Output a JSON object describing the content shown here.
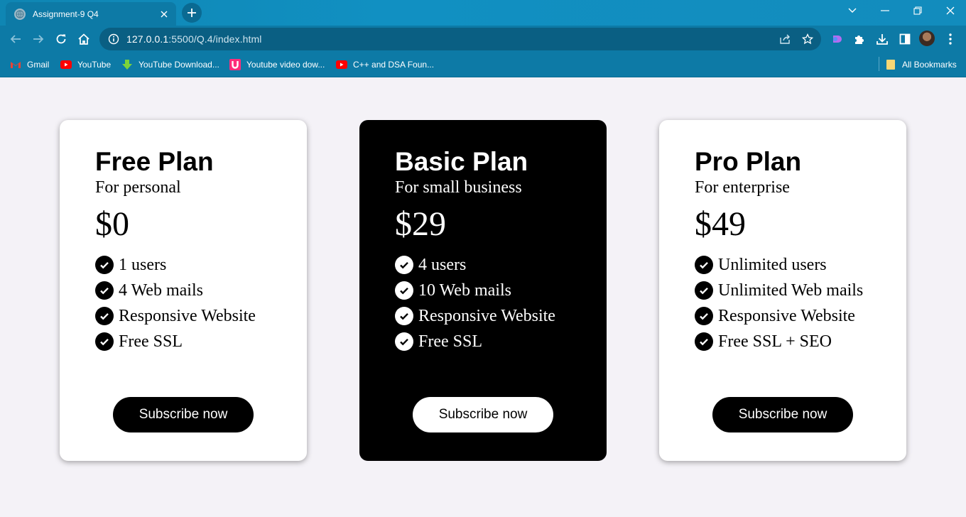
{
  "browser": {
    "tab_title": "Assignment-9 Q4",
    "url_host": "127.0.0.1",
    "url_rest": ":5500/Q.4/index.html",
    "bookmarks": [
      {
        "label": "Gmail",
        "icon": "gmail-icon"
      },
      {
        "label": "YouTube",
        "icon": "youtube-icon"
      },
      {
        "label": "YouTube Download...",
        "icon": "download-arrow-icon"
      },
      {
        "label": "Youtube video dow...",
        "icon": "u-logo-icon"
      },
      {
        "label": "C++ and DSA Foun...",
        "icon": "youtube-icon"
      }
    ],
    "all_bookmarks": "All Bookmarks"
  },
  "plans": [
    {
      "name": "Free Plan",
      "subtitle": "For personal",
      "price": "$0",
      "features": [
        "1 users",
        "4 Web mails",
        "Responsive Website",
        "Free SSL"
      ],
      "button": "Subscribe now",
      "theme": "light"
    },
    {
      "name": "Basic Plan",
      "subtitle": "For small business",
      "price": "$29",
      "features": [
        "4 users",
        "10 Web mails",
        "Responsive Website",
        "Free SSL"
      ],
      "button": "Subscribe now",
      "theme": "dark"
    },
    {
      "name": "Pro Plan",
      "subtitle": "For enterprise",
      "price": "$49",
      "features": [
        "Unlimited users",
        "Unlimited Web mails",
        "Responsive Website",
        "Free SSL + SEO"
      ],
      "button": "Subscribe now",
      "theme": "light"
    }
  ],
  "colors": {
    "chrome": "#0d7aa6",
    "page_bg": "#f4f2f7",
    "card_light": "#ffffff",
    "card_dark": "#000000"
  }
}
